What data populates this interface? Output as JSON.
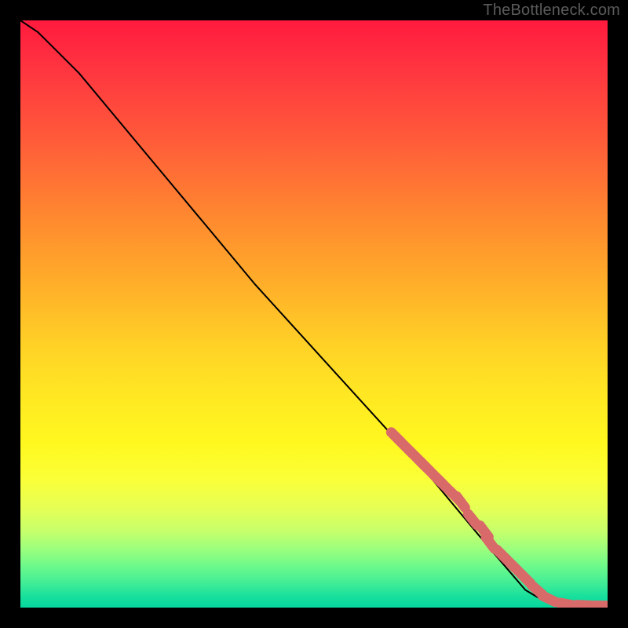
{
  "attribution": "TheBottleneck.com",
  "chart_data": {
    "type": "line",
    "title": "",
    "xlabel": "",
    "ylabel": "",
    "xlim": [
      0,
      100
    ],
    "ylim": [
      0,
      100
    ],
    "grid": false,
    "legend": false,
    "note": "No axis ticks or numeric labels are rendered in the image; x/y ranges are normalized 0–100. Curve and marker positions are estimated from pixel geometry.",
    "series": [
      {
        "name": "curve",
        "style": "line",
        "color": "#000000",
        "x": [
          0,
          3,
          6,
          10,
          20,
          30,
          40,
          50,
          60,
          70,
          80,
          86,
          88,
          90,
          92,
          94,
          96,
          98,
          100
        ],
        "y": [
          100,
          98,
          95,
          91,
          79,
          67,
          55,
          44,
          33,
          22,
          10,
          3,
          1.8,
          1.0,
          0.6,
          0.4,
          0.3,
          0.3,
          0.3
        ]
      },
      {
        "name": "highlighted-points",
        "style": "scatter",
        "color": "#d96a6a",
        "x": [
          64,
          66,
          68,
          69,
          71,
          72,
          74,
          75,
          77,
          79,
          80,
          82,
          84,
          86,
          88,
          90,
          93,
          96,
          99,
          100
        ],
        "y": [
          29,
          27,
          25,
          24,
          22,
          21,
          19,
          18,
          15,
          13,
          11,
          9,
          7,
          5,
          3,
          1.5,
          0.6,
          0.4,
          0.3,
          0.3
        ]
      }
    ]
  }
}
